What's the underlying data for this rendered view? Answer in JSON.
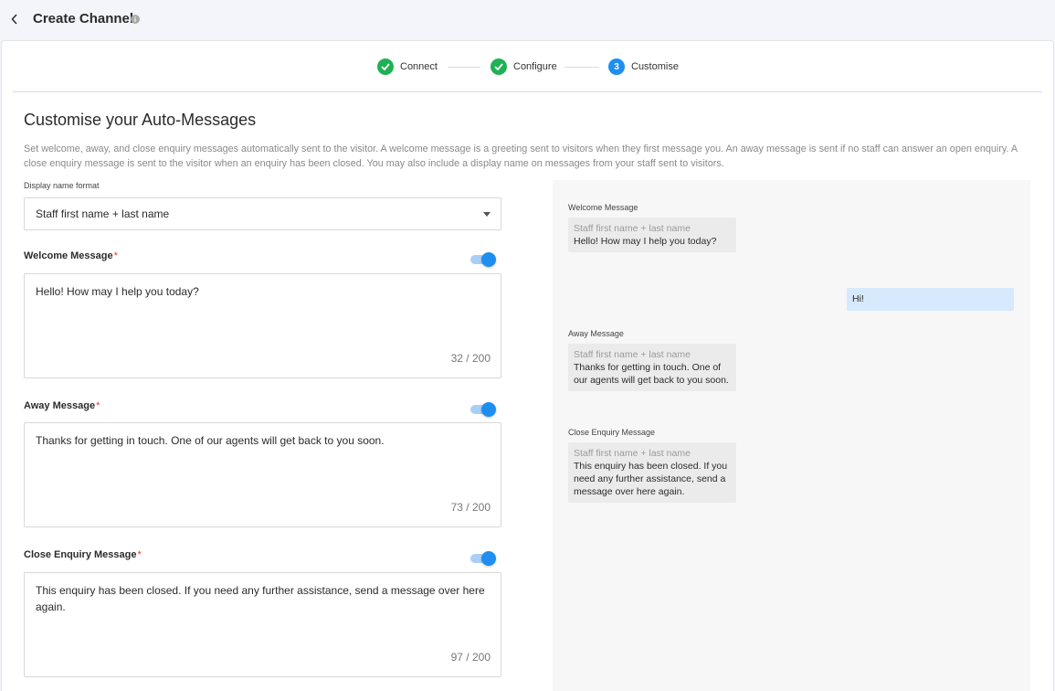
{
  "header": {
    "title": "Create Channel",
    "back_icon": "chevron-left-icon",
    "info_icon": "info-icon"
  },
  "stepper": {
    "steps": [
      {
        "label": "Connect",
        "state": "done"
      },
      {
        "label": "Configure",
        "state": "done"
      },
      {
        "label": "Customise",
        "state": "active",
        "number": "3"
      }
    ],
    "done_color": "#1fb155",
    "active_color": "#1e8ef0"
  },
  "section": {
    "title": "Customise your Auto-Messages",
    "description": "Set welcome, away, and close enquiry messages automatically sent to the visitor. A welcome message is a greeting sent to visitors when they first message you. An away message is sent if no staff can answer an open enquiry. A close enquiry message is sent to the visitor when an enquiry has been closed. You may also include a display name on messages from your staff sent to visitors."
  },
  "display_name": {
    "label": "Display name format",
    "value": "Staff first name + last name"
  },
  "messages": {
    "welcome": {
      "label": "Welcome Message",
      "required": "*",
      "enabled": true,
      "text": "Hello! How may I help you today?",
      "count": "32 / 200"
    },
    "away": {
      "label": "Away Message",
      "required": "*",
      "enabled": true,
      "text": "Thanks for getting in touch. One of our agents will get back to you soon.",
      "count": "73 / 200"
    },
    "close": {
      "label": "Close Enquiry Message",
      "required": "*",
      "enabled": true,
      "text": "This enquiry has been closed. If you need any further assistance, send a message over here again.",
      "count": "97 / 200"
    }
  },
  "preview": {
    "welcome": {
      "label": "Welcome Message",
      "sender": "Staff first name + last name",
      "text": "Hello! How may I help you today?"
    },
    "user_reply": "Hi!",
    "away": {
      "label": "Away Message",
      "sender": "Staff first name + last name",
      "text": "Thanks for getting in touch. One of our agents will get back to you soon."
    },
    "close": {
      "label": "Close Enquiry Message",
      "sender": "Staff first name + last name",
      "text": "This enquiry has been closed. If you need any further assistance, send a message over here again."
    }
  },
  "colors": {
    "accent": "#1e8ef0",
    "success": "#1fb155",
    "required": "#e53935"
  }
}
